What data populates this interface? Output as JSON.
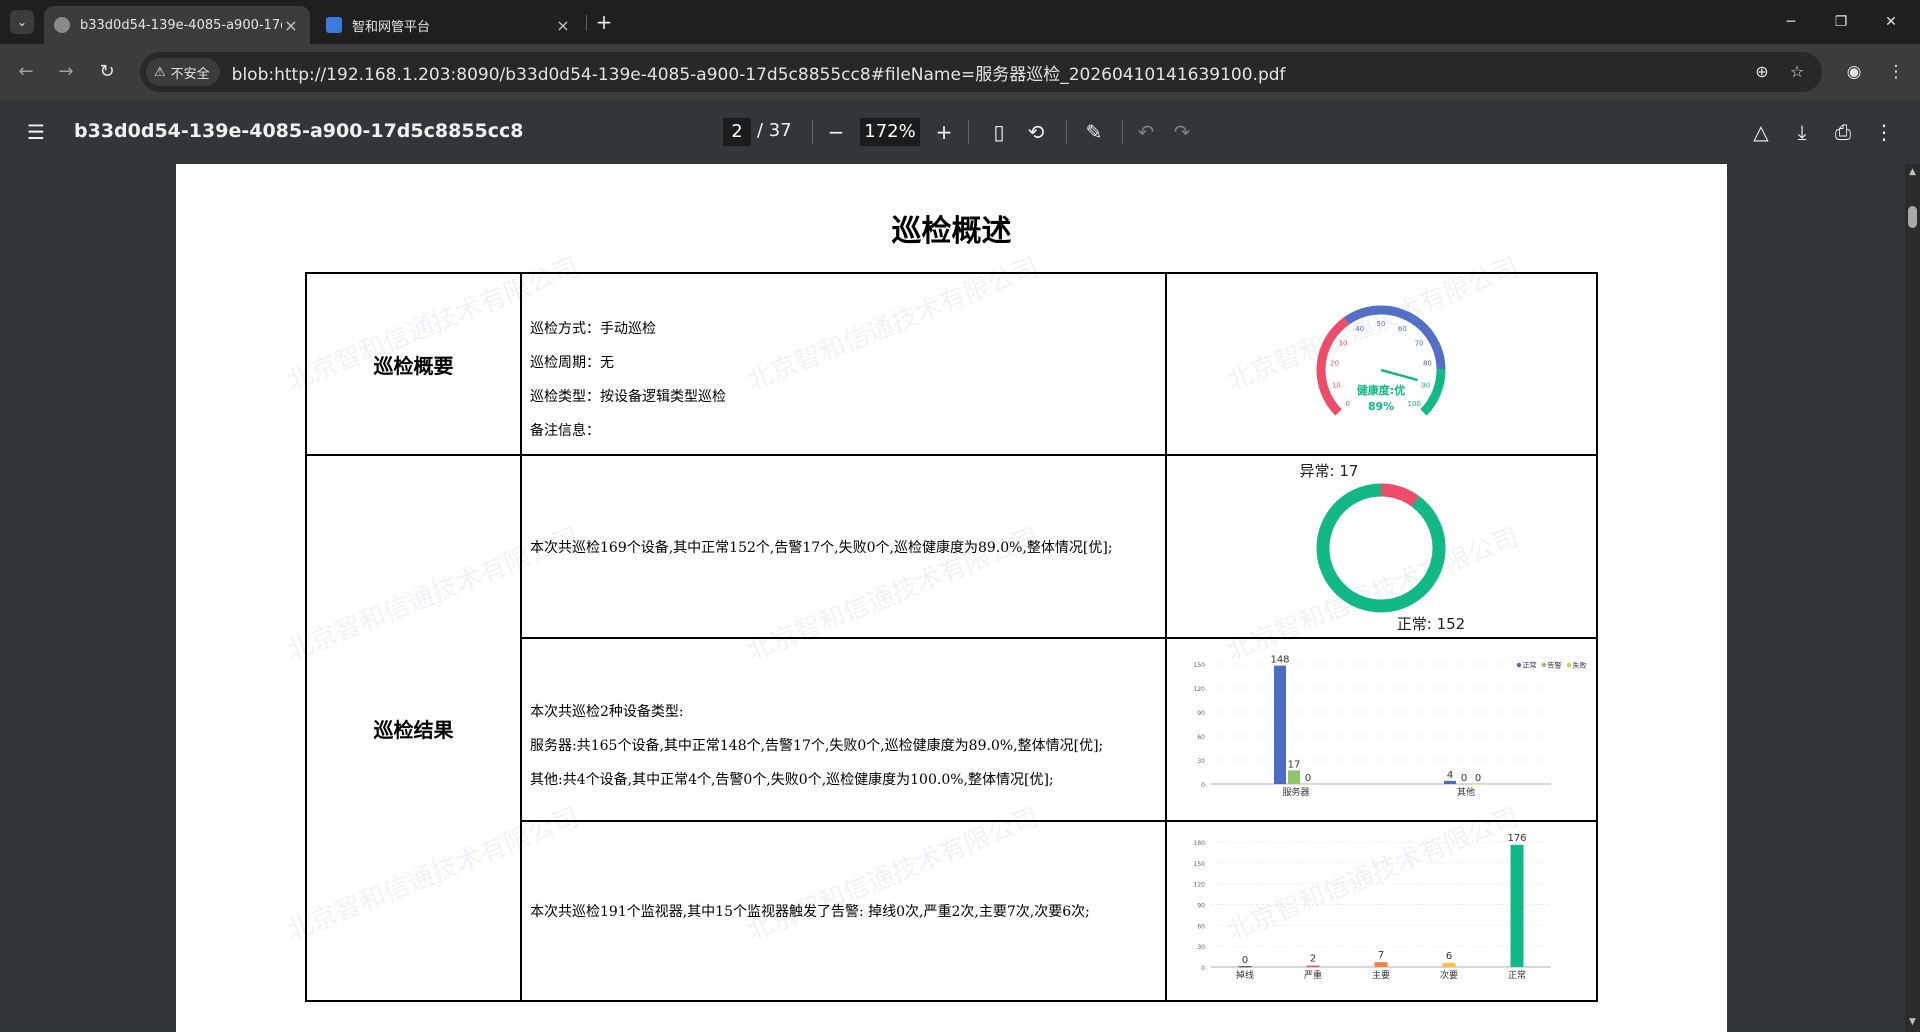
{
  "browser": {
    "tabs": [
      {
        "title": "b33d0d54-139e-4085-a900-17d"
      },
      {
        "title": "智和网管平台"
      }
    ],
    "security_label": "不安全",
    "url": "blob:http://192.168.1.203:8090/b33d0d54-139e-4085-a900-17d5c8855cc8#fileName=服务器巡检_20260410141639100.pdf"
  },
  "pdf": {
    "title": "b33d0d54-139e-4085-a900-17d5c8855cc8",
    "page_current": "2",
    "page_total": "/ 37",
    "zoom": "172%"
  },
  "document": {
    "heading": "巡检概述",
    "overview": {
      "label": "巡检概要",
      "lines": [
        "巡检方式：手动巡检",
        "巡检周期：无",
        "巡检类型：按设备逻辑类型巡检",
        "备注信息："
      ]
    },
    "results": {
      "label": "巡检结果",
      "row1_text": "本次共巡检169个设备,其中正常152个,告警17个,失败0个,巡检健康度为89.0%,整体情况[优];",
      "row2_lines": [
        "本次共巡检2种设备类型:",
        "服务器:共165个设备,其中正常148个,告警17个,失败0个,巡检健康度为89.0%,整体情况[优];",
        "其他:共4个设备,其中正常4个,告警0个,失败0个,巡检健康度为100.0%,整体情况[优];"
      ],
      "row3_text": "本次共巡检191个监视器,其中15个监视器触发了告警: 掉线0次,严重2次,主要7次,次要6次;"
    },
    "watermark": "北京智和信通技术有限公司"
  },
  "chart_data": [
    {
      "type": "gauge",
      "value": 89,
      "label": "健康度:优",
      "value_text": "89%",
      "scale": [
        "0",
        "10",
        "20",
        "30",
        "40",
        "50",
        "60",
        "70",
        "80",
        "90",
        "100"
      ],
      "min": 0,
      "max": 100,
      "colors": {
        "low": "#ee4d6a",
        "mid": "#5470c6",
        "high": "#12b886"
      }
    },
    {
      "type": "pie",
      "slices": [
        {
          "name": "异常",
          "value": 17,
          "color": "#ee4d6a",
          "label": "异常: 17"
        },
        {
          "name": "正常",
          "value": 152,
          "color": "#12b886",
          "label": "正常: 152"
        }
      ]
    },
    {
      "type": "bar",
      "categories": [
        "服务器",
        "其他"
      ],
      "series": [
        {
          "name": "正常",
          "values": [
            148,
            4
          ],
          "color": "#4c6bc3"
        },
        {
          "name": "告警",
          "values": [
            17,
            0
          ],
          "color": "#8cc56b"
        },
        {
          "name": "失败",
          "values": [
            0,
            0
          ],
          "color": "#f5c242"
        }
      ],
      "yticks": [
        "0",
        "30",
        "60",
        "90",
        "120",
        "150"
      ],
      "ylim": [
        0,
        150
      ],
      "legend": "top-right"
    },
    {
      "type": "bar",
      "categories": [
        "掉线",
        "严重",
        "主要",
        "次要",
        "正常"
      ],
      "values": [
        0,
        2,
        7,
        6,
        176
      ],
      "colors": [
        "#666666",
        "#ee4d6a",
        "#f0803c",
        "#f5c242",
        "#12b886"
      ],
      "yticks": [
        "0",
        "30",
        "60",
        "90",
        "120",
        "150",
        "180"
      ],
      "ylim": [
        0,
        180
      ]
    }
  ]
}
